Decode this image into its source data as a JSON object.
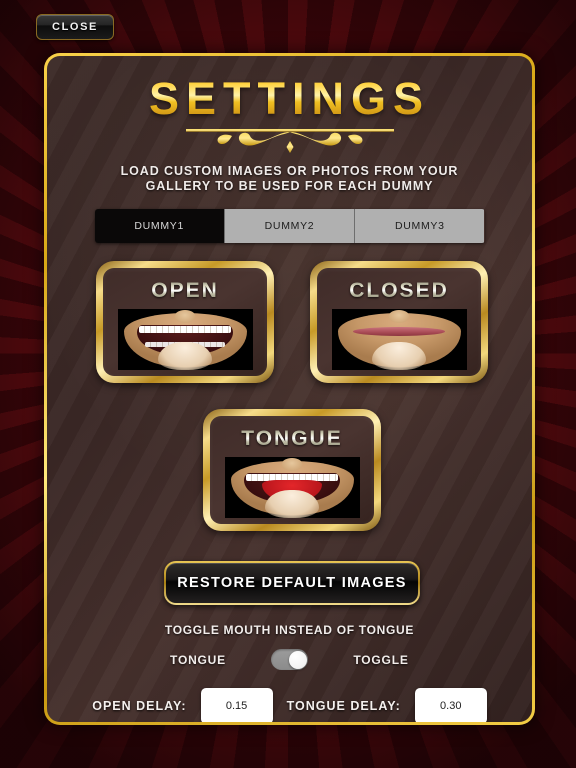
{
  "window": {
    "close_label": "CLOSE"
  },
  "panel": {
    "title": "SETTINGS",
    "instructions_line1": "LOAD CUSTOM IMAGES OR PHOTOS FROM YOUR",
    "instructions_line2": "GALLERY TO BE USED FOR EACH DUMMY"
  },
  "segmented": {
    "selected": "DUMMY1",
    "options": [
      {
        "label": "DUMMY1",
        "active": true
      },
      {
        "label": "DUMMY2",
        "active": false
      },
      {
        "label": "DUMMY3",
        "active": false
      }
    ]
  },
  "cards": [
    {
      "label": "OPEN"
    },
    {
      "label": "CLOSED"
    },
    {
      "label": "TONGUE"
    }
  ],
  "restore": {
    "label": "RESTORE DEFAULT IMAGES"
  },
  "toggle": {
    "caption": "TOGGLE MOUTH INSTEAD OF TONGUE",
    "left_label": "TONGUE",
    "right_label": "TOGGLE",
    "state": "on"
  },
  "delays": {
    "open_label": "OPEN DELAY:",
    "open_value": "0.15",
    "tongue_label": "TONGUE DELAY:",
    "tongue_value": "0.30"
  },
  "colors": {
    "gold": "#f2cf4a",
    "panel_bg": "#3c2a27",
    "background_red": "#6b0d12",
    "segment_active_bg": "#0a0808",
    "segment_inactive_bg": "#b0b0b0"
  }
}
